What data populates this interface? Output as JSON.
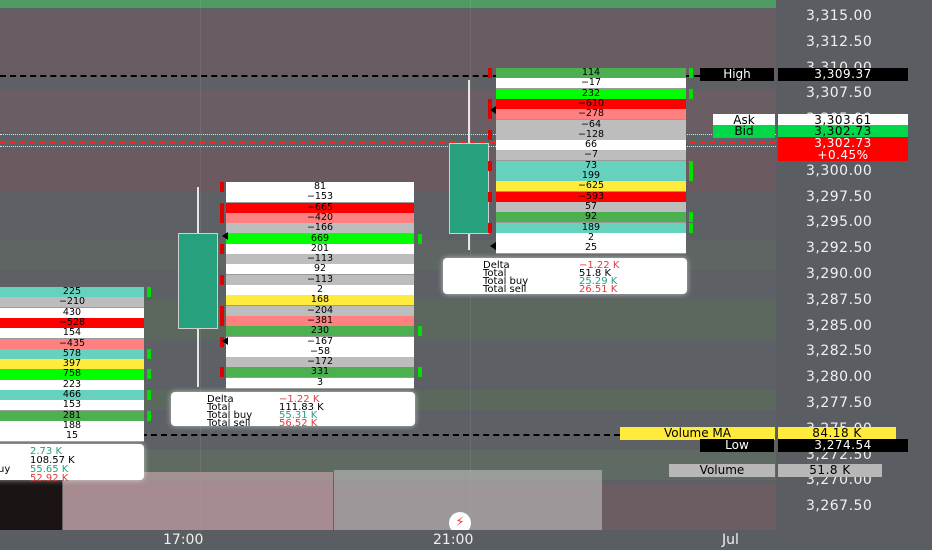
{
  "price_axis": {
    "labels": [
      "3,315.00",
      "3,312.50",
      "3,310.00",
      "3,307.50",
      "3,305.00",
      "3,302.50",
      "3,300.00",
      "3,297.50",
      "3,295.00",
      "3,292.50",
      "3,290.00",
      "3,287.50",
      "3,285.00",
      "3,282.50",
      "3,280.00",
      "3,277.50",
      "3,275.00",
      "3,272.50",
      "3,270.00",
      "3,267.50"
    ]
  },
  "tags": {
    "high_label": "High",
    "high_value": "3,309.37",
    "ask_label": "Ask",
    "ask_value": "3,303.61",
    "bid_label": "Bid",
    "bid_value": "3,302.73",
    "last_value": "3,302.73",
    "last_change": "+0.45%",
    "volume_ma_label": "Volume MA",
    "volume_ma_value": "84.18 K",
    "low_label": "Low",
    "low_value": "3,274.54",
    "volume_label": "Volume",
    "volume_value": "51.8 K"
  },
  "time_axis": {
    "labels": [
      "17:00",
      "21:00",
      "Jul"
    ]
  },
  "colors": {
    "white": "#ffffff",
    "grey": "#bdbdbd",
    "red": "#ff0000",
    "pink": "#ff8080",
    "green": "#00ff00",
    "dkgreen": "#4caf50",
    "teal": "#66d2be",
    "yellow": "#ffeb3b"
  },
  "footprint_left": {
    "rows": [
      {
        "v": "225",
        "c": "teal"
      },
      {
        "v": "−210",
        "c": "grey"
      },
      {
        "v": "430",
        "c": "white"
      },
      {
        "v": "−528",
        "c": "red"
      },
      {
        "v": "154",
        "c": "white"
      },
      {
        "v": "−435",
        "c": "pink"
      },
      {
        "v": "578",
        "c": "teal"
      },
      {
        "v": "397",
        "c": "yellow"
      },
      {
        "v": "758",
        "c": "green"
      },
      {
        "v": "223",
        "c": "white"
      },
      {
        "v": "466",
        "c": "teal"
      },
      {
        "v": "153",
        "c": "white"
      },
      {
        "v": "281",
        "c": "dkgreen"
      },
      {
        "v": "188",
        "c": "white"
      },
      {
        "v": "15",
        "c": "white"
      }
    ]
  },
  "footprint_mid": {
    "rows": [
      {
        "v": "81",
        "c": "white"
      },
      {
        "v": "−153",
        "c": "white"
      },
      {
        "v": "−665",
        "c": "red"
      },
      {
        "v": "−420",
        "c": "pink"
      },
      {
        "v": "−166",
        "c": "grey"
      },
      {
        "v": "669",
        "c": "green"
      },
      {
        "v": "201",
        "c": "white"
      },
      {
        "v": "−113",
        "c": "grey"
      },
      {
        "v": "92",
        "c": "white"
      },
      {
        "v": "−113",
        "c": "grey"
      },
      {
        "v": "2",
        "c": "white"
      },
      {
        "v": "168",
        "c": "yellow"
      },
      {
        "v": "−204",
        "c": "grey"
      },
      {
        "v": "−381",
        "c": "pink"
      },
      {
        "v": "230",
        "c": "dkgreen"
      },
      {
        "v": "−167",
        "c": "white"
      },
      {
        "v": "−58",
        "c": "white"
      },
      {
        "v": "−172",
        "c": "grey"
      },
      {
        "v": "331",
        "c": "dkgreen"
      },
      {
        "v": "3",
        "c": "white"
      }
    ]
  },
  "footprint_right": {
    "rows": [
      {
        "v": "114",
        "c": "dkgreen"
      },
      {
        "v": "−17",
        "c": "white"
      },
      {
        "v": "232",
        "c": "green"
      },
      {
        "v": "−610",
        "c": "red"
      },
      {
        "v": "−278",
        "c": "pink"
      },
      {
        "v": "−64",
        "c": "grey"
      },
      {
        "v": "−128",
        "c": "grey"
      },
      {
        "v": "66",
        "c": "white"
      },
      {
        "v": "−7",
        "c": "grey"
      },
      {
        "v": "73",
        "c": "teal"
      },
      {
        "v": "199",
        "c": "teal"
      },
      {
        "v": "−625",
        "c": "yellow"
      },
      {
        "v": "−593",
        "c": "red"
      },
      {
        "v": "57",
        "c": "grey"
      },
      {
        "v": "92",
        "c": "dkgreen"
      },
      {
        "v": "189",
        "c": "teal"
      },
      {
        "v": "2",
        "c": "white"
      },
      {
        "v": "25",
        "c": "white"
      }
    ]
  },
  "summary_left": {
    "delta": "2.73 K",
    "total": "108.57 K",
    "buy_label": "uy",
    "buy": "55.65 K",
    "sell": "52.92 K"
  },
  "summary_mid": {
    "delta_label": "Delta",
    "delta": "−1.22 K",
    "total_label": "Total",
    "total": "111.83 K",
    "buy_label": "Total buy",
    "buy": "55.31 K",
    "sell_label": "Total sell",
    "sell": "56.52 K"
  },
  "summary_right": {
    "delta_label": "Delta",
    "delta": "−1.22 K",
    "total_label": "Total",
    "total": "51.8 K",
    "buy_label": "Total buy",
    "buy": "25.29 K",
    "sell_label": "Total sell",
    "sell": "26.51 K"
  }
}
